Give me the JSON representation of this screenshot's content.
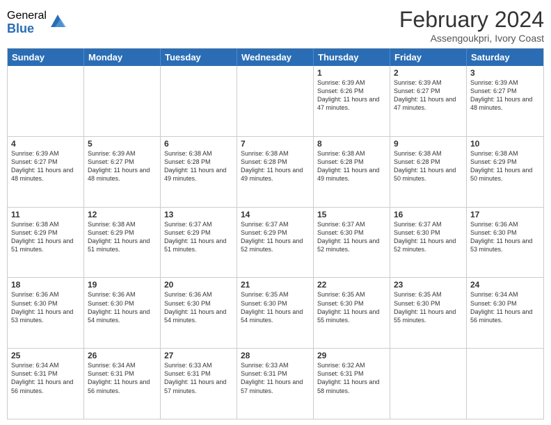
{
  "logo": {
    "general": "General",
    "blue": "Blue"
  },
  "title": "February 2024",
  "location": "Assengoukpri, Ivory Coast",
  "days_of_week": [
    "Sunday",
    "Monday",
    "Tuesday",
    "Wednesday",
    "Thursday",
    "Friday",
    "Saturday"
  ],
  "weeks": [
    [
      {
        "day": "",
        "info": ""
      },
      {
        "day": "",
        "info": ""
      },
      {
        "day": "",
        "info": ""
      },
      {
        "day": "",
        "info": ""
      },
      {
        "day": "1",
        "info": "Sunrise: 6:39 AM\nSunset: 6:26 PM\nDaylight: 11 hours\nand 47 minutes."
      },
      {
        "day": "2",
        "info": "Sunrise: 6:39 AM\nSunset: 6:27 PM\nDaylight: 11 hours\nand 47 minutes."
      },
      {
        "day": "3",
        "info": "Sunrise: 6:39 AM\nSunset: 6:27 PM\nDaylight: 11 hours\nand 48 minutes."
      }
    ],
    [
      {
        "day": "4",
        "info": "Sunrise: 6:39 AM\nSunset: 6:27 PM\nDaylight: 11 hours\nand 48 minutes."
      },
      {
        "day": "5",
        "info": "Sunrise: 6:39 AM\nSunset: 6:27 PM\nDaylight: 11 hours\nand 48 minutes."
      },
      {
        "day": "6",
        "info": "Sunrise: 6:38 AM\nSunset: 6:28 PM\nDaylight: 11 hours\nand 49 minutes."
      },
      {
        "day": "7",
        "info": "Sunrise: 6:38 AM\nSunset: 6:28 PM\nDaylight: 11 hours\nand 49 minutes."
      },
      {
        "day": "8",
        "info": "Sunrise: 6:38 AM\nSunset: 6:28 PM\nDaylight: 11 hours\nand 49 minutes."
      },
      {
        "day": "9",
        "info": "Sunrise: 6:38 AM\nSunset: 6:28 PM\nDaylight: 11 hours\nand 50 minutes."
      },
      {
        "day": "10",
        "info": "Sunrise: 6:38 AM\nSunset: 6:29 PM\nDaylight: 11 hours\nand 50 minutes."
      }
    ],
    [
      {
        "day": "11",
        "info": "Sunrise: 6:38 AM\nSunset: 6:29 PM\nDaylight: 11 hours\nand 51 minutes."
      },
      {
        "day": "12",
        "info": "Sunrise: 6:38 AM\nSunset: 6:29 PM\nDaylight: 11 hours\nand 51 minutes."
      },
      {
        "day": "13",
        "info": "Sunrise: 6:37 AM\nSunset: 6:29 PM\nDaylight: 11 hours\nand 51 minutes."
      },
      {
        "day": "14",
        "info": "Sunrise: 6:37 AM\nSunset: 6:29 PM\nDaylight: 11 hours\nand 52 minutes."
      },
      {
        "day": "15",
        "info": "Sunrise: 6:37 AM\nSunset: 6:30 PM\nDaylight: 11 hours\nand 52 minutes."
      },
      {
        "day": "16",
        "info": "Sunrise: 6:37 AM\nSunset: 6:30 PM\nDaylight: 11 hours\nand 52 minutes."
      },
      {
        "day": "17",
        "info": "Sunrise: 6:36 AM\nSunset: 6:30 PM\nDaylight: 11 hours\nand 53 minutes."
      }
    ],
    [
      {
        "day": "18",
        "info": "Sunrise: 6:36 AM\nSunset: 6:30 PM\nDaylight: 11 hours\nand 53 minutes."
      },
      {
        "day": "19",
        "info": "Sunrise: 6:36 AM\nSunset: 6:30 PM\nDaylight: 11 hours\nand 54 minutes."
      },
      {
        "day": "20",
        "info": "Sunrise: 6:36 AM\nSunset: 6:30 PM\nDaylight: 11 hours\nand 54 minutes."
      },
      {
        "day": "21",
        "info": "Sunrise: 6:35 AM\nSunset: 6:30 PM\nDaylight: 11 hours\nand 54 minutes."
      },
      {
        "day": "22",
        "info": "Sunrise: 6:35 AM\nSunset: 6:30 PM\nDaylight: 11 hours\nand 55 minutes."
      },
      {
        "day": "23",
        "info": "Sunrise: 6:35 AM\nSunset: 6:30 PM\nDaylight: 11 hours\nand 55 minutes."
      },
      {
        "day": "24",
        "info": "Sunrise: 6:34 AM\nSunset: 6:30 PM\nDaylight: 11 hours\nand 56 minutes."
      }
    ],
    [
      {
        "day": "25",
        "info": "Sunrise: 6:34 AM\nSunset: 6:31 PM\nDaylight: 11 hours\nand 56 minutes."
      },
      {
        "day": "26",
        "info": "Sunrise: 6:34 AM\nSunset: 6:31 PM\nDaylight: 11 hours\nand 56 minutes."
      },
      {
        "day": "27",
        "info": "Sunrise: 6:33 AM\nSunset: 6:31 PM\nDaylight: 11 hours\nand 57 minutes."
      },
      {
        "day": "28",
        "info": "Sunrise: 6:33 AM\nSunset: 6:31 PM\nDaylight: 11 hours\nand 57 minutes."
      },
      {
        "day": "29",
        "info": "Sunrise: 6:32 AM\nSunset: 6:31 PM\nDaylight: 11 hours\nand 58 minutes."
      },
      {
        "day": "",
        "info": ""
      },
      {
        "day": "",
        "info": ""
      }
    ]
  ]
}
